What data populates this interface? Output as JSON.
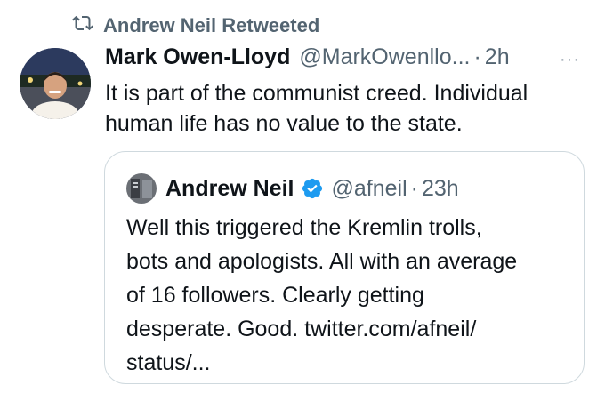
{
  "retweet": {
    "icon": "retweet-icon",
    "label": "Andrew Neil Retweeted"
  },
  "tweet": {
    "author_name": "Mark Owen-Lloyd",
    "author_handle": "@MarkOwenllo...",
    "separator": "·",
    "time": "2h",
    "more": "···",
    "text": "It is part of the communist creed. Individual human life has no value to the state."
  },
  "quoted": {
    "author_name": "Andrew Neil",
    "author_handle": "@afneil",
    "separator": "·",
    "time": "23h",
    "text_lines": [
      "Well this triggered the Kremlin trolls,",
      "bots and apologists. All with an average",
      "of 16 followers. Clearly getting",
      "desperate. Good. twitter.com/afneil/",
      "status/..."
    ]
  },
  "colors": {
    "text": "#0f1419",
    "muted": "#536471",
    "verified": "#1d9bf0",
    "border": "#cfd9de"
  }
}
